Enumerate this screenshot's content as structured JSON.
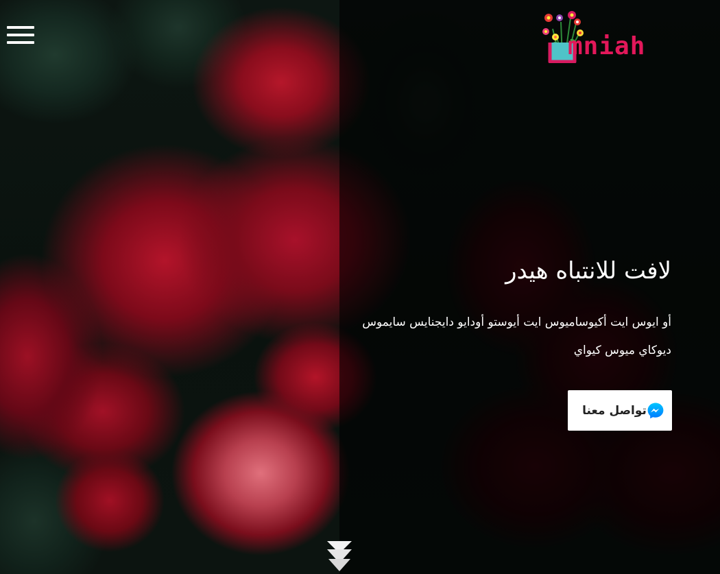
{
  "header": {
    "menu_icon": "hamburger-menu-icon",
    "logo": {
      "text": "Umniah",
      "icon": "flower-pot-logo-icon",
      "colors": {
        "text": "#e2185a",
        "pot": "#4fc3c8"
      }
    }
  },
  "hero": {
    "title": "لافت للانتباه هيدر",
    "text": "أو ايوس ايت أكيوساميوس ايت أيوستو أودايو دايجنايس سايموس ديوكاي ميوس كيواي",
    "button": {
      "label": "تواصل معنا",
      "icon": "messenger-icon",
      "icon_color": "#0084ff"
    },
    "scroll_icon": "double-chevron-down-icon"
  },
  "colors": {
    "overlay": "rgba(0,0,0,0.6)",
    "text": "#ffffff",
    "button_bg": "#ffffff",
    "button_text": "#222222"
  }
}
